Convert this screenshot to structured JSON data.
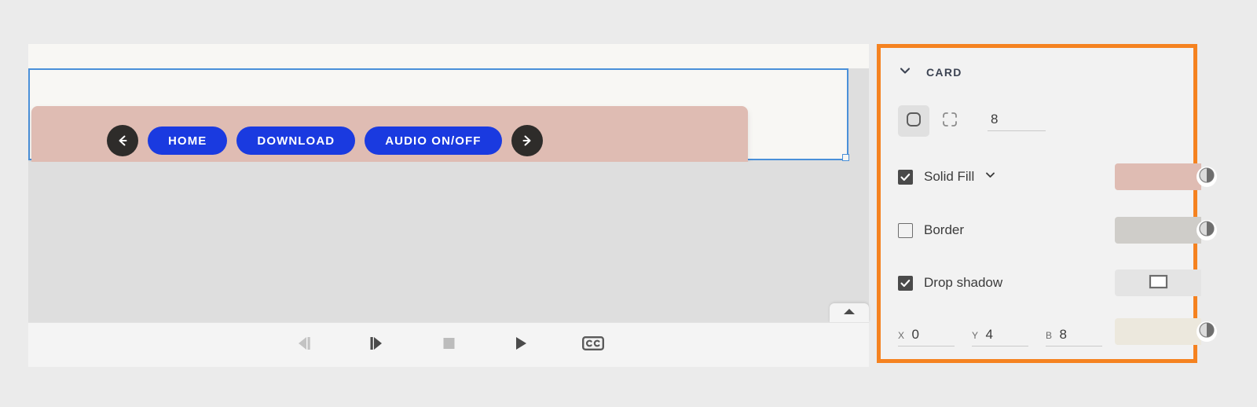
{
  "canvas": {
    "card": {
      "back_button_icon": "arrow-left-icon",
      "forward_button_icon": "arrow-right-icon",
      "buttons": [
        {
          "label": "HOME"
        },
        {
          "label": "DOWNLOAD"
        },
        {
          "label": "AUDIO ON/OFF"
        }
      ],
      "fill_color": "#dfbcb3",
      "button_color": "#1a3ae0",
      "selection_color": "#4a90d9"
    }
  },
  "playback": {
    "controls": [
      {
        "name": "step-backward-icon",
        "label": "Step backward",
        "enabled": false
      },
      {
        "name": "step-forward-icon",
        "label": "Step forward",
        "enabled": true
      },
      {
        "name": "stop-icon",
        "label": "Stop",
        "enabled": true
      },
      {
        "name": "play-icon",
        "label": "Play",
        "enabled": true
      },
      {
        "name": "closed-caption-icon",
        "label": "CC",
        "enabled": true
      }
    ],
    "collapse_icon": "chevron-up-icon"
  },
  "panel": {
    "accent_color": "#f58220",
    "collapse_icon": "chevron-down-icon",
    "title": "CARD",
    "corner_radius": {
      "rounded_icon": "rounded-corner-icon",
      "individual_icon": "individual-corners-icon",
      "value": "8"
    },
    "fill": {
      "checked": true,
      "label": "Solid Fill",
      "dropdown_icon": "chevron-down-icon",
      "color": "#dfbcb3",
      "opacity_icon": "opacity-icon"
    },
    "border": {
      "checked": false,
      "label": "Border",
      "color": "#cfcdc9",
      "opacity_icon": "opacity-icon"
    },
    "drop_shadow": {
      "checked": true,
      "label": "Drop shadow",
      "preview_icon": "shadow-preview-icon",
      "color": "#ece8dd",
      "opacity_icon": "opacity-icon",
      "fields": [
        {
          "label": "X",
          "value": "0"
        },
        {
          "label": "Y",
          "value": "4"
        },
        {
          "label": "B",
          "value": "8"
        }
      ]
    }
  }
}
